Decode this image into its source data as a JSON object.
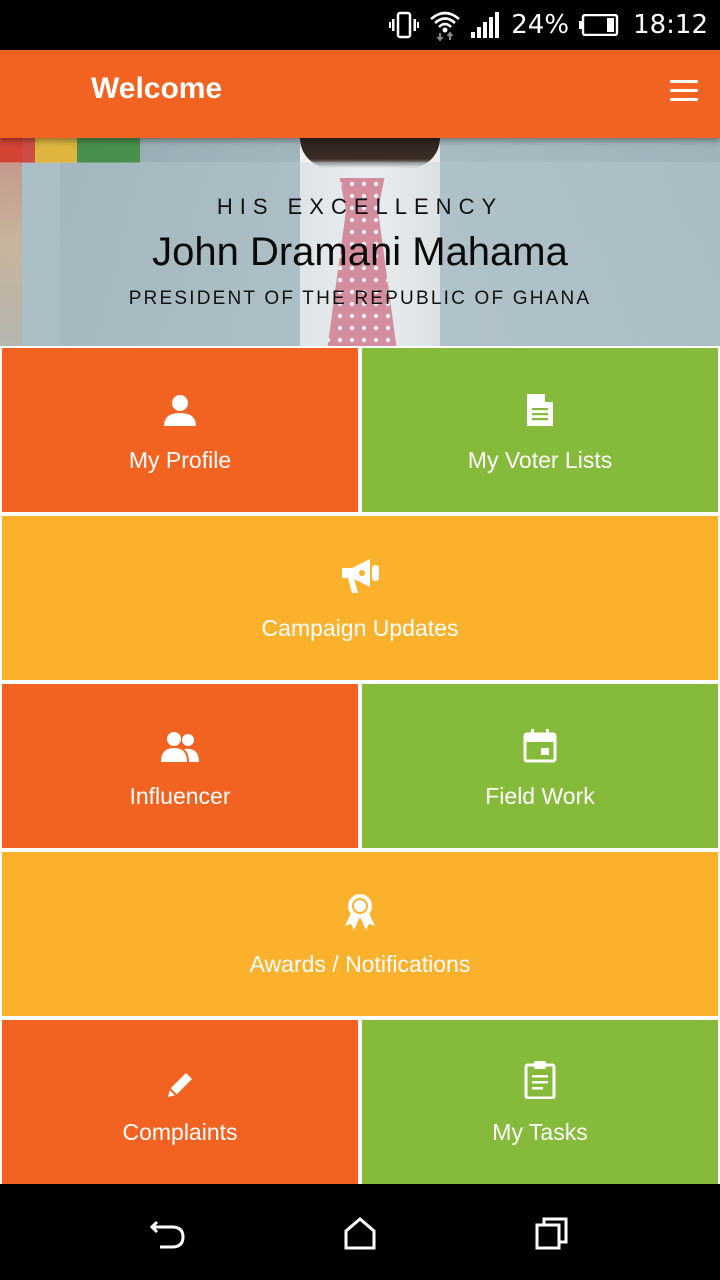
{
  "status_bar": {
    "battery_percent": "24%",
    "time": "18:12",
    "icons": [
      "vibrate-icon",
      "wifi-icon",
      "signal-icon",
      "battery-icon"
    ]
  },
  "app_bar": {
    "title": "Welcome",
    "menu_icon": "hamburger-menu-icon"
  },
  "banner": {
    "honorific": "HIS EXCELLENCY",
    "name": "John Dramani Mahama",
    "title": "PRESIDENT OF THE REPUBLIC OF GHANA"
  },
  "tiles": [
    {
      "label": "My Profile",
      "icon": "person-icon",
      "color": "#F26322"
    },
    {
      "label": "My Voter Lists",
      "icon": "document-icon",
      "color": "#86BA3A"
    },
    {
      "label": "Campaign Updates",
      "icon": "megaphone-icon",
      "color": "#FBB12B"
    },
    {
      "label": "Influencer",
      "icon": "people-icon",
      "color": "#F26322"
    },
    {
      "label": "Field Work",
      "icon": "calendar-icon",
      "color": "#86BA3A"
    },
    {
      "label": "Awards / Notifications",
      "icon": "award-ribbon-icon",
      "color": "#FBB12B"
    },
    {
      "label": "Complaints",
      "icon": "pencil-icon",
      "color": "#F26322"
    },
    {
      "label": "My Tasks",
      "icon": "clipboard-icon",
      "color": "#86BA3A"
    }
  ],
  "nav_bar": {
    "icons": [
      "back-icon",
      "home-icon",
      "recent-apps-icon"
    ]
  }
}
